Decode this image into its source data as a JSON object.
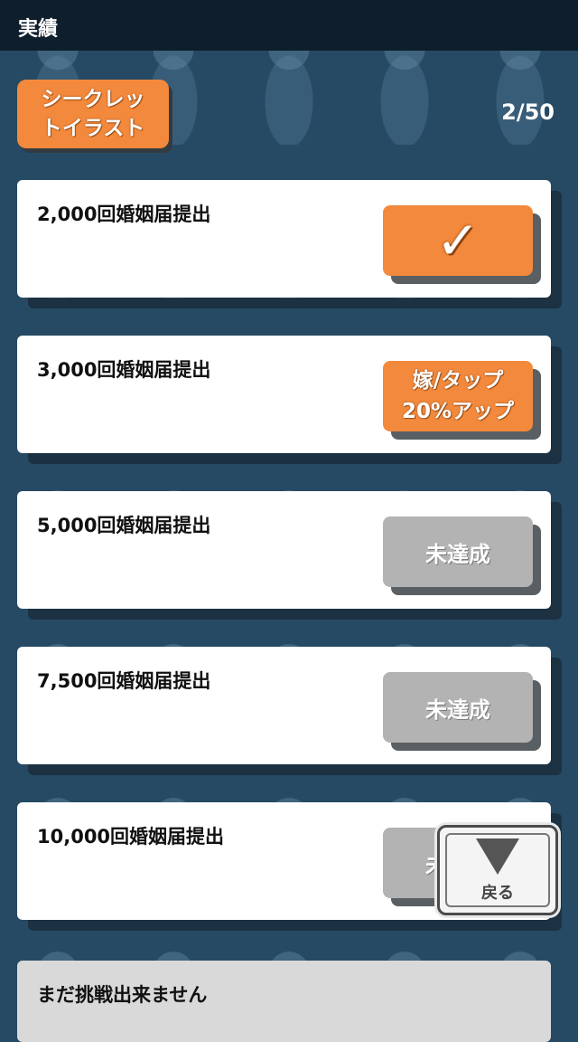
{
  "header": {
    "title": "実績"
  },
  "category": {
    "label_line1": "シークレッ",
    "label_line2": "トイラスト"
  },
  "progress": {
    "count": "2/50"
  },
  "achievements": [
    {
      "label": "2,000回婚姻届提出",
      "status": "completed",
      "badge": "✓"
    },
    {
      "label": "3,000回婚姻届提出",
      "status": "reward",
      "badge_line1": "嫁/タップ",
      "badge_line2": "20%アップ"
    },
    {
      "label": "5,000回婚姻届提出",
      "status": "incomplete",
      "badge": "未達成"
    },
    {
      "label": "7,500回婚姻届提出",
      "status": "incomplete",
      "badge": "未達成"
    },
    {
      "label": "10,000回婚姻届提出",
      "status": "incomplete",
      "badge": "未達成"
    }
  ],
  "locked": {
    "label": "まだ挑戦出来ません"
  },
  "back_button": {
    "label": "戻る",
    "icon": "down-triangle-icon"
  },
  "colors": {
    "accent": "#f2893c",
    "background": "#264a63",
    "topbar": "#0f1e2c",
    "incomplete": "#b3b3b3"
  }
}
